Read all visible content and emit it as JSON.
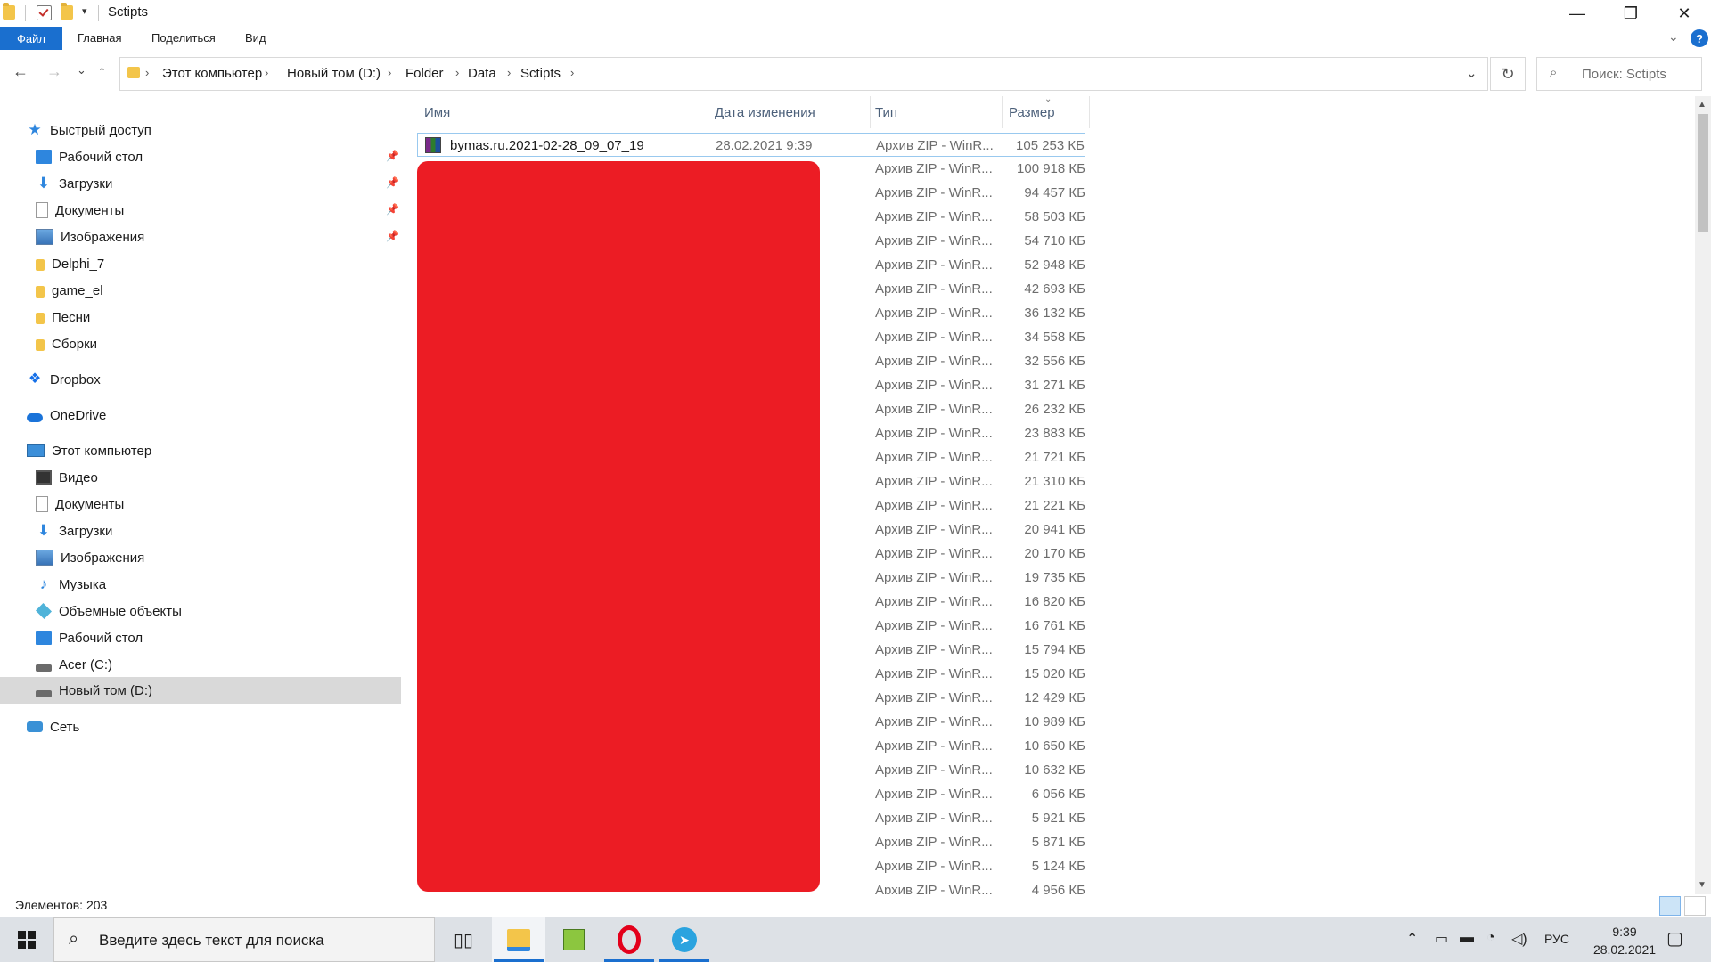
{
  "window": {
    "title": "Sctipts",
    "minimize_glyph": "—",
    "restore_glyph": "❐",
    "close_glyph": "✕"
  },
  "ribbon": {
    "tabs": [
      "Файл",
      "Главная",
      "Поделиться",
      "Вид"
    ],
    "help_glyph": "?"
  },
  "nav": {
    "back": "←",
    "forward": "→",
    "recent": "⌄",
    "up": "↑",
    "refresh": "↻",
    "address_dropdown": "⌄"
  },
  "breadcrumb": [
    "Этот компьютер",
    "Новый том (D:)",
    "Folder",
    "Data",
    "Sctipts"
  ],
  "search": {
    "placeholder": "Поиск: Sctipts",
    "icon": "search-icon"
  },
  "sidebar": {
    "quick_access": {
      "label": "Быстрый доступ",
      "items": [
        {
          "label": "Рабочий стол",
          "icon": "desktop-icon",
          "pinned": true
        },
        {
          "label": "Загрузки",
          "icon": "download-icon",
          "pinned": true
        },
        {
          "label": "Документы",
          "icon": "documents-icon",
          "pinned": true
        },
        {
          "label": "Изображения",
          "icon": "pictures-icon",
          "pinned": true
        },
        {
          "label": "Delphi_7",
          "icon": "folder-icon",
          "pinned": false
        },
        {
          "label": "game_el",
          "icon": "folder-icon",
          "pinned": false
        },
        {
          "label": "Песни",
          "icon": "folder-icon",
          "pinned": false
        },
        {
          "label": "Сборки",
          "icon": "folder-icon",
          "pinned": false
        }
      ]
    },
    "dropbox": "Dropbox",
    "onedrive": "OneDrive",
    "this_pc": {
      "label": "Этот компьютер",
      "items": [
        {
          "label": "Видео",
          "icon": "video-icon"
        },
        {
          "label": "Документы",
          "icon": "documents-icon"
        },
        {
          "label": "Загрузки",
          "icon": "download-icon"
        },
        {
          "label": "Изображения",
          "icon": "pictures-icon"
        },
        {
          "label": "Музыка",
          "icon": "music-icon"
        },
        {
          "label": "Объемные объекты",
          "icon": "3d-objects-icon"
        },
        {
          "label": "Рабочий стол",
          "icon": "desktop-icon"
        },
        {
          "label": "Acer (C:)",
          "icon": "drive-icon"
        },
        {
          "label": "Новый том (D:)",
          "icon": "drive-icon",
          "selected": true
        }
      ]
    },
    "network": "Сеть",
    "pin_glyph": "📌"
  },
  "columns": {
    "name": "Имя",
    "date": "Дата изменения",
    "type": "Тип",
    "size": "Размер",
    "sort_glyph": "⌄"
  },
  "files": [
    {
      "name": "bymas.ru.2021-02-28_09_07_19",
      "date": "28.02.2021 9:39",
      "type": "Архив ZIP - WinR...",
      "size": "105 253 КБ",
      "selected": true
    },
    {
      "name": "",
      "date": "",
      "type": "Архив ZIP - WinR...",
      "size": "100 918 КБ"
    },
    {
      "name": "",
      "date": "",
      "type": "Архив ZIP - WinR...",
      "size": "94 457 КБ"
    },
    {
      "name": "",
      "date": "",
      "type": "Архив ZIP - WinR...",
      "size": "58 503 КБ"
    },
    {
      "name": "",
      "date": "",
      "type": "Архив ZIP - WinR...",
      "size": "54 710 КБ"
    },
    {
      "name": "",
      "date": "",
      "type": "Архив ZIP - WinR...",
      "size": "52 948 КБ"
    },
    {
      "name": "",
      "date": "",
      "type": "Архив ZIP - WinR...",
      "size": "42 693 КБ"
    },
    {
      "name": "",
      "date": "",
      "type": "Архив ZIP - WinR...",
      "size": "36 132 КБ"
    },
    {
      "name": "",
      "date": "",
      "type": "Архив ZIP - WinR...",
      "size": "34 558 КБ"
    },
    {
      "name": "",
      "date": "",
      "type": "Архив ZIP - WinR...",
      "size": "32 556 КБ"
    },
    {
      "name": "",
      "date": "",
      "type": "Архив ZIP - WinR...",
      "size": "31 271 КБ"
    },
    {
      "name": "",
      "date": "",
      "type": "Архив ZIP - WinR...",
      "size": "26 232 КБ"
    },
    {
      "name": "",
      "date": "",
      "type": "Архив ZIP - WinR...",
      "size": "23 883 КБ"
    },
    {
      "name": "",
      "date": "",
      "type": "Архив ZIP - WinR...",
      "size": "21 721 КБ"
    },
    {
      "name": "",
      "date": "",
      "type": "Архив ZIP - WinR...",
      "size": "21 310 КБ"
    },
    {
      "name": "",
      "date": "",
      "type": "Архив ZIP - WinR...",
      "size": "21 221 КБ"
    },
    {
      "name": "",
      "date": "",
      "type": "Архив ZIP - WinR...",
      "size": "20 941 КБ"
    },
    {
      "name": "",
      "date": "",
      "type": "Архив ZIP - WinR...",
      "size": "20 170 КБ"
    },
    {
      "name": "",
      "date": "",
      "type": "Архив ZIP - WinR...",
      "size": "19 735 КБ"
    },
    {
      "name": "",
      "date": "",
      "type": "Архив ZIP - WinR...",
      "size": "16 820 КБ"
    },
    {
      "name": "",
      "date": "",
      "type": "Архив ZIP - WinR...",
      "size": "16 761 КБ"
    },
    {
      "name": "",
      "date": "",
      "type": "Архив ZIP - WinR...",
      "size": "15 794 КБ"
    },
    {
      "name": "",
      "date": "",
      "type": "Архив ZIP - WinR...",
      "size": "15 020 КБ"
    },
    {
      "name": "",
      "date": "",
      "type": "Архив ZIP - WinR...",
      "size": "12 429 КБ"
    },
    {
      "name": "",
      "date": "",
      "type": "Архив ZIP - WinR...",
      "size": "10 989 КБ"
    },
    {
      "name": "",
      "date": "",
      "type": "Архив ZIP - WinR...",
      "size": "10 650 КБ"
    },
    {
      "name": "",
      "date": "",
      "type": "Архив ZIP - WinR...",
      "size": "10 632 КБ"
    },
    {
      "name": "",
      "date": "",
      "type": "Архив ZIP - WinR...",
      "size": "6 056 КБ"
    },
    {
      "name": "",
      "date": "",
      "type": "Архив ZIP - WinR...",
      "size": "5 921 КБ"
    },
    {
      "name": "",
      "date": "",
      "type": "Архив ZIP - WinR...",
      "size": "5 871 КБ"
    },
    {
      "name": "",
      "date": "",
      "type": "Архив ZIP - WinR...",
      "size": "5 124 КБ"
    },
    {
      "name": "",
      "date": "",
      "type": "Архив ZIP - WinR...",
      "size": "4 956 КБ"
    }
  ],
  "status": {
    "items_count": "Элементов: 203"
  },
  "taskbar": {
    "search_placeholder": "Введите здесь текст для поиска",
    "language": "РУС",
    "time": "9:39",
    "date": "28.02.2021",
    "apps": [
      "task-view-icon",
      "file-explorer-icon",
      "notepad-icon",
      "opera-icon",
      "telegram-icon"
    ]
  },
  "colors": {
    "accent": "#1a6fcf",
    "redaction": "#ec1c24",
    "selected_nav": "#d9d9d9"
  }
}
